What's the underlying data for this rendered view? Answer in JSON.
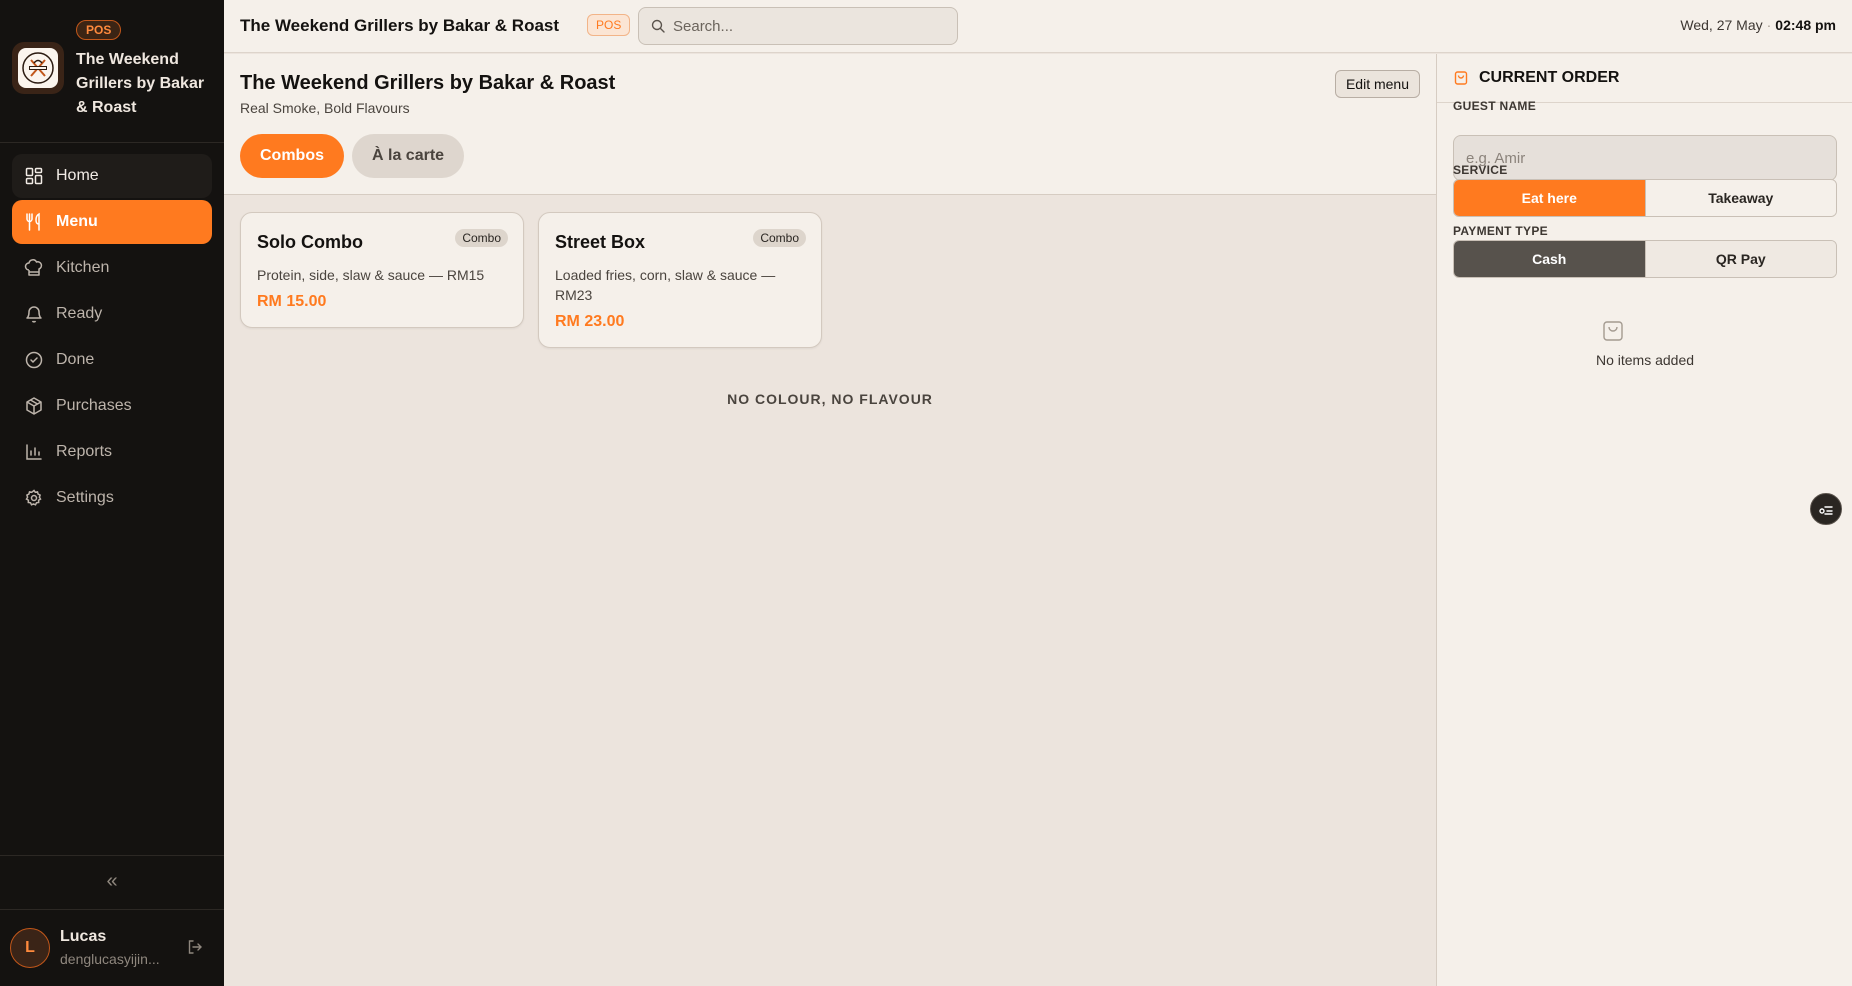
{
  "sidebar": {
    "badge": "POS",
    "brand_name": "The Weekend Grillers by Bakar & Roast",
    "logo_icon": "grill-logo",
    "items": [
      {
        "label": "Home",
        "icon": "grid-icon"
      },
      {
        "label": "Menu",
        "icon": "utensils-icon"
      },
      {
        "label": "Kitchen",
        "icon": "chef-hat-icon"
      },
      {
        "label": "Ready",
        "icon": "bell-icon"
      },
      {
        "label": "Done",
        "icon": "check-circle-icon"
      },
      {
        "label": "Purchases",
        "icon": "package-icon"
      },
      {
        "label": "Reports",
        "icon": "bar-chart-icon"
      },
      {
        "label": "Settings",
        "icon": "gear-icon"
      }
    ],
    "collapse_glyph": "«",
    "user": {
      "initial": "L",
      "name": "Lucas",
      "email": "denglucasyijin..."
    }
  },
  "topbar": {
    "title": "The Weekend Grillers by Bakar & Roast",
    "badge": "POS",
    "search_placeholder": "Search...",
    "date": "Wed, 27 May",
    "separator": "·",
    "time": "02:48 pm"
  },
  "menu": {
    "title": "The Weekend Grillers by Bakar & Roast",
    "subtitle": "Real Smoke, Bold Flavours",
    "edit_label": "Edit menu",
    "tabs": [
      {
        "label": "Combos",
        "active": true
      },
      {
        "label": "À la carte",
        "active": false
      }
    ],
    "items": [
      {
        "name": "Solo Combo",
        "badge": "Combo",
        "description": "Protein, side, slaw & sauce — RM15",
        "price": "RM 15.00"
      },
      {
        "name": "Street Box",
        "badge": "Combo",
        "description": "Loaded fries, corn, slaw & sauce — RM23",
        "price": "RM 23.00"
      }
    ],
    "tagline": "NO COLOUR, NO FLAVOUR"
  },
  "order": {
    "title": "CURRENT ORDER",
    "guest_label": "GUEST NAME",
    "guest_placeholder": "e.g. Amir",
    "service_label": "SERVICE",
    "service_options": [
      "Eat here",
      "Takeaway"
    ],
    "service_selected": "Eat here",
    "payment_label": "PAYMENT TYPE",
    "payment_options": [
      "Cash",
      "QR Pay"
    ],
    "payment_selected": "Cash",
    "empty_text": "No items added"
  },
  "colors": {
    "accent": "#ff7a1f",
    "sidebar_bg": "#141210",
    "panel_bg": "#f5f0ea",
    "main_bg": "#ece4dd"
  }
}
